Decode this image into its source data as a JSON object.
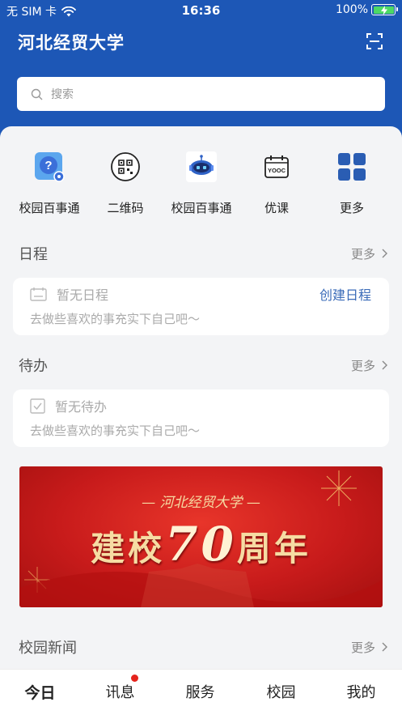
{
  "status_bar": {
    "carrier": "无 SIM 卡",
    "time": "16:36",
    "battery": "100%",
    "wifi_icon": "wifi-icon",
    "battery_icon": "battery-charging-icon"
  },
  "header": {
    "title": "河北经贸大学",
    "scan_icon": "scan-icon",
    "bg_color": "#1d57b6"
  },
  "search": {
    "placeholder": "搜索",
    "icon": "search-icon"
  },
  "quick_actions": [
    {
      "label": "校园百事通",
      "icon": "help-question-icon"
    },
    {
      "label": "二维码",
      "icon": "qrcode-icon"
    },
    {
      "label": "校园百事通",
      "icon": "robot-icon"
    },
    {
      "label": "优课",
      "icon": "yooc-calendar-icon"
    },
    {
      "label": "更多",
      "icon": "grid-more-icon"
    }
  ],
  "schedule": {
    "title": "日程",
    "more": "更多",
    "empty": "暂无日程",
    "action": "创建日程",
    "hint": "去做些喜欢的事充实下自己吧～"
  },
  "todo": {
    "title": "待办",
    "more": "更多",
    "empty": "暂无待办",
    "hint": "去做些喜欢的事充实下自己吧～"
  },
  "banner": {
    "top_text": "— 河北经贸大学 —",
    "main_left": "建校",
    "main_num": "70",
    "main_right": "周年"
  },
  "news": {
    "title": "校园新闻",
    "more": "更多"
  },
  "tabs": [
    {
      "label": "今日",
      "active": true
    },
    {
      "label": "讯息",
      "badge": true
    },
    {
      "label": "服务"
    },
    {
      "label": "校园"
    },
    {
      "label": "我的"
    }
  ],
  "colors": {
    "accent": "#1d57b6",
    "link": "#3a6bb8",
    "badge": "#e5241d"
  }
}
